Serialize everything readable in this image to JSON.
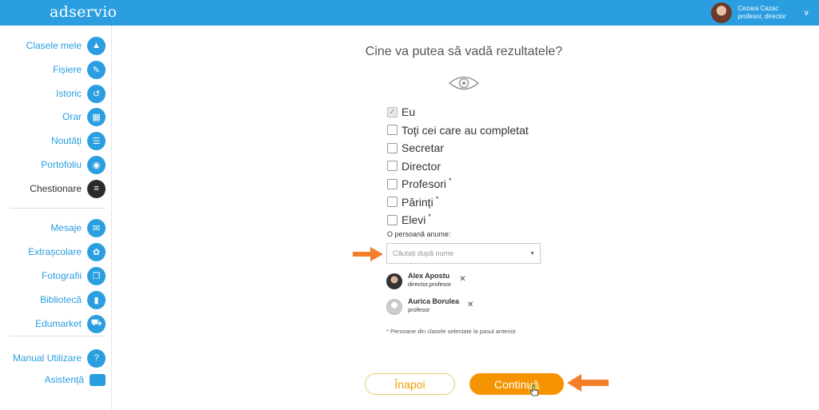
{
  "app": {
    "logo": "adservio"
  },
  "user": {
    "name": "Cezara Cazac",
    "role": "profesor, director"
  },
  "sidebar": {
    "items": [
      {
        "label": "Clasele mele",
        "icon": "class-icon",
        "glyph": "▲",
        "active": false
      },
      {
        "label": "Fișiere",
        "icon": "paperclip-icon",
        "glyph": "✎",
        "active": false
      },
      {
        "label": "Istoric",
        "icon": "history-icon",
        "glyph": "↺",
        "active": false
      },
      {
        "label": "Orar",
        "icon": "calendar-icon",
        "glyph": "▦",
        "active": false
      },
      {
        "label": "Noutăți",
        "icon": "news-icon",
        "glyph": "☰",
        "active": false
      },
      {
        "label": "Portofoliu",
        "icon": "portfolio-icon",
        "glyph": "◉",
        "active": false
      },
      {
        "label": "Chestionare",
        "icon": "questionnaire-icon",
        "glyph": "≡",
        "active": true
      }
    ],
    "items2": [
      {
        "label": "Mesaje",
        "icon": "mail-icon",
        "glyph": "✉"
      },
      {
        "label": "Extrașcolare",
        "icon": "activities-icon",
        "glyph": "✿"
      },
      {
        "label": "Fotografii",
        "icon": "photos-icon",
        "glyph": "❐"
      },
      {
        "label": "Bibliotecă",
        "icon": "library-icon",
        "glyph": "▮"
      },
      {
        "label": "Edumarket",
        "icon": "cart-icon",
        "glyph": "⛟"
      }
    ],
    "items3": [
      {
        "label": "Manual Utilizare",
        "icon": "help-icon",
        "glyph": "?"
      },
      {
        "label": "Asistență",
        "icon": "chat-icon",
        "glyph": ""
      }
    ]
  },
  "main": {
    "heading": "Cine va putea să vadă rezultatele?",
    "options": [
      {
        "label": "Eu",
        "checked": true,
        "sup": ""
      },
      {
        "label": "Toţi cei care au completat",
        "checked": false,
        "sup": ""
      },
      {
        "label": "Secretar",
        "checked": false,
        "sup": ""
      },
      {
        "label": "Director",
        "checked": false,
        "sup": ""
      },
      {
        "label": "Profesori",
        "checked": false,
        "sup": "*"
      },
      {
        "label": "Părinți",
        "checked": false,
        "sup": "*"
      },
      {
        "label": "Elevi",
        "checked": false,
        "sup": "*"
      }
    ],
    "person_label": "O persoană anume:",
    "search_placeholder": "Căutați după nume",
    "selected_people": [
      {
        "name": "Alex Apostu",
        "role": "director,profesor"
      },
      {
        "name": "Aurica Borulea",
        "role": "profesor"
      }
    ],
    "footnote": "* Persoane din clasele selectate la pasul anterior",
    "back_label": "Înapoi",
    "continue_label": "Continuă"
  },
  "colors": {
    "primary": "#2a9ee0",
    "accent": "#f59400",
    "annotation_arrow": "#f27e2a"
  }
}
